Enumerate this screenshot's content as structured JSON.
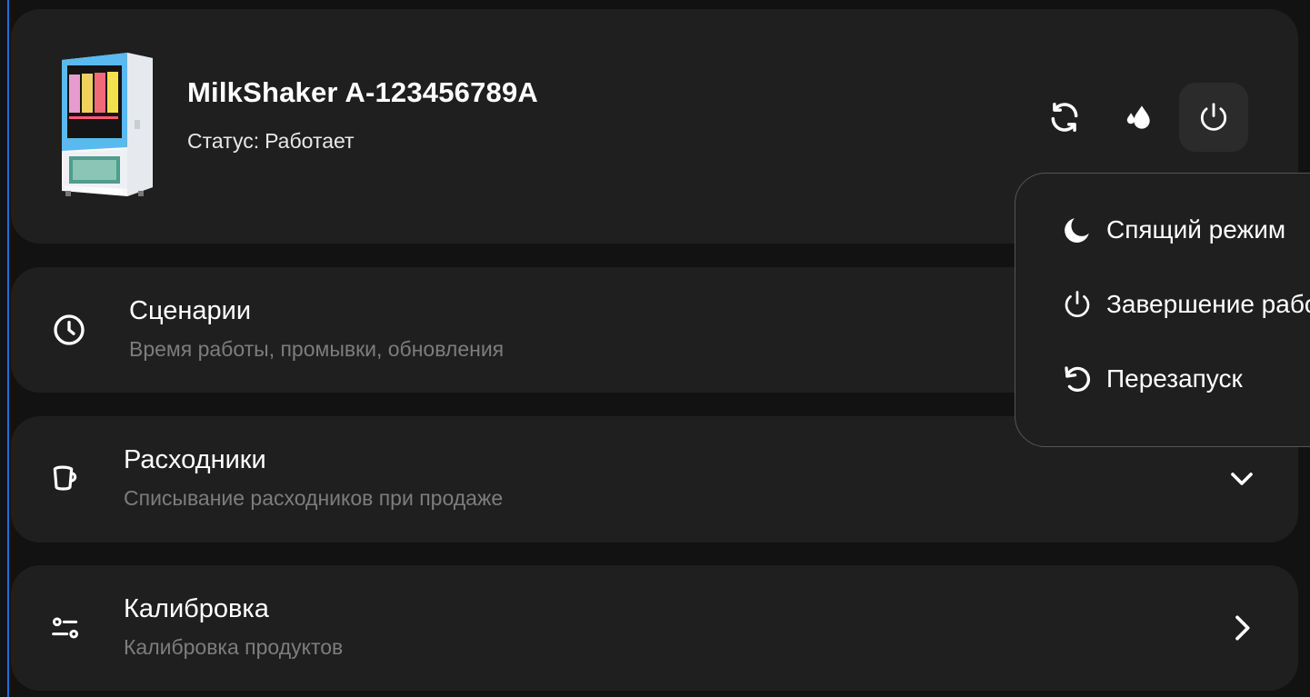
{
  "device": {
    "name": "MilkShaker A-123456789A",
    "status_label": "Статус:",
    "status_value": "Работает"
  },
  "actions": {
    "icons": [
      "refresh-icon",
      "droplets-icon",
      "power-icon"
    ]
  },
  "power_menu": {
    "items": [
      {
        "label": "Спящий режим",
        "icon": "moon-icon"
      },
      {
        "label": "Завершение работы",
        "icon": "power-icon"
      },
      {
        "label": "Перезапуск",
        "icon": "restart-icon"
      }
    ]
  },
  "settings": [
    {
      "title": "Сценарии",
      "subtitle": "Время работы, промывки, обновления",
      "icon": "clock-icon"
    },
    {
      "title": "Расходники",
      "subtitle": "Списывание расходников при продаже",
      "icon": "cup-icon",
      "chevron": "chevron-down-icon"
    },
    {
      "title": "Калибровка",
      "subtitle": "Калибровка продуктов",
      "icon": "sliders-icon",
      "chevron": "chevron-right-icon"
    }
  ],
  "colors": {
    "background": "#121212",
    "card": "#1f1f1f",
    "accent_line": "#1e6fd9",
    "subtitle": "#7d7d7d",
    "menu_border": "#555555"
  }
}
